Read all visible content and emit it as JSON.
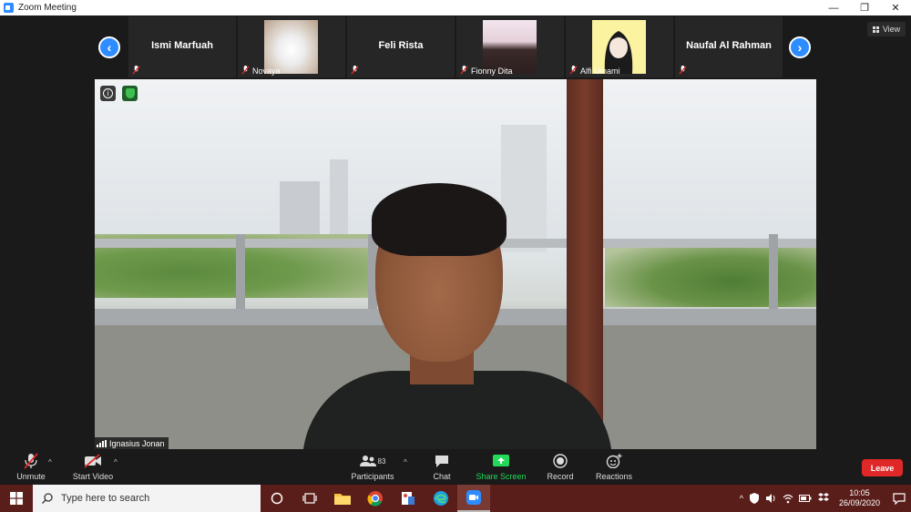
{
  "window": {
    "title": "Zoom Meeting",
    "controls": [
      "—",
      "❐",
      "✕"
    ]
  },
  "participants_strip": [
    {
      "name": "Ismi Marfuah",
      "has_video": false
    },
    {
      "name": "Novaya",
      "has_video": true,
      "photo": "cat"
    },
    {
      "name": "Feli Rista",
      "has_video": false
    },
    {
      "name": "Fionny Dita",
      "has_video": true,
      "photo": "girl"
    },
    {
      "name": "Alfi Umami",
      "has_video": true,
      "photo": "anime"
    },
    {
      "name": "Naufal Al Rahman",
      "has_video": false
    }
  ],
  "view_button": {
    "label": "View"
  },
  "main_video": {
    "speaker": "Ignasius Jonan"
  },
  "toolbar": {
    "unmute": "Unmute",
    "start_video": "Start Video",
    "participants": "Participants",
    "participants_count": "83",
    "chat": "Chat",
    "share_screen": "Share Screen",
    "record": "Record",
    "reactions": "Reactions",
    "leave": "Leave"
  },
  "taskbar": {
    "search_placeholder": "Type here to search",
    "time": "10:05",
    "date": "26/09/2020"
  },
  "colors": {
    "zoom_blue": "#2d8cff",
    "share_green": "#23d959",
    "leave_red": "#e02828",
    "taskbar": "#5a1e1a"
  }
}
